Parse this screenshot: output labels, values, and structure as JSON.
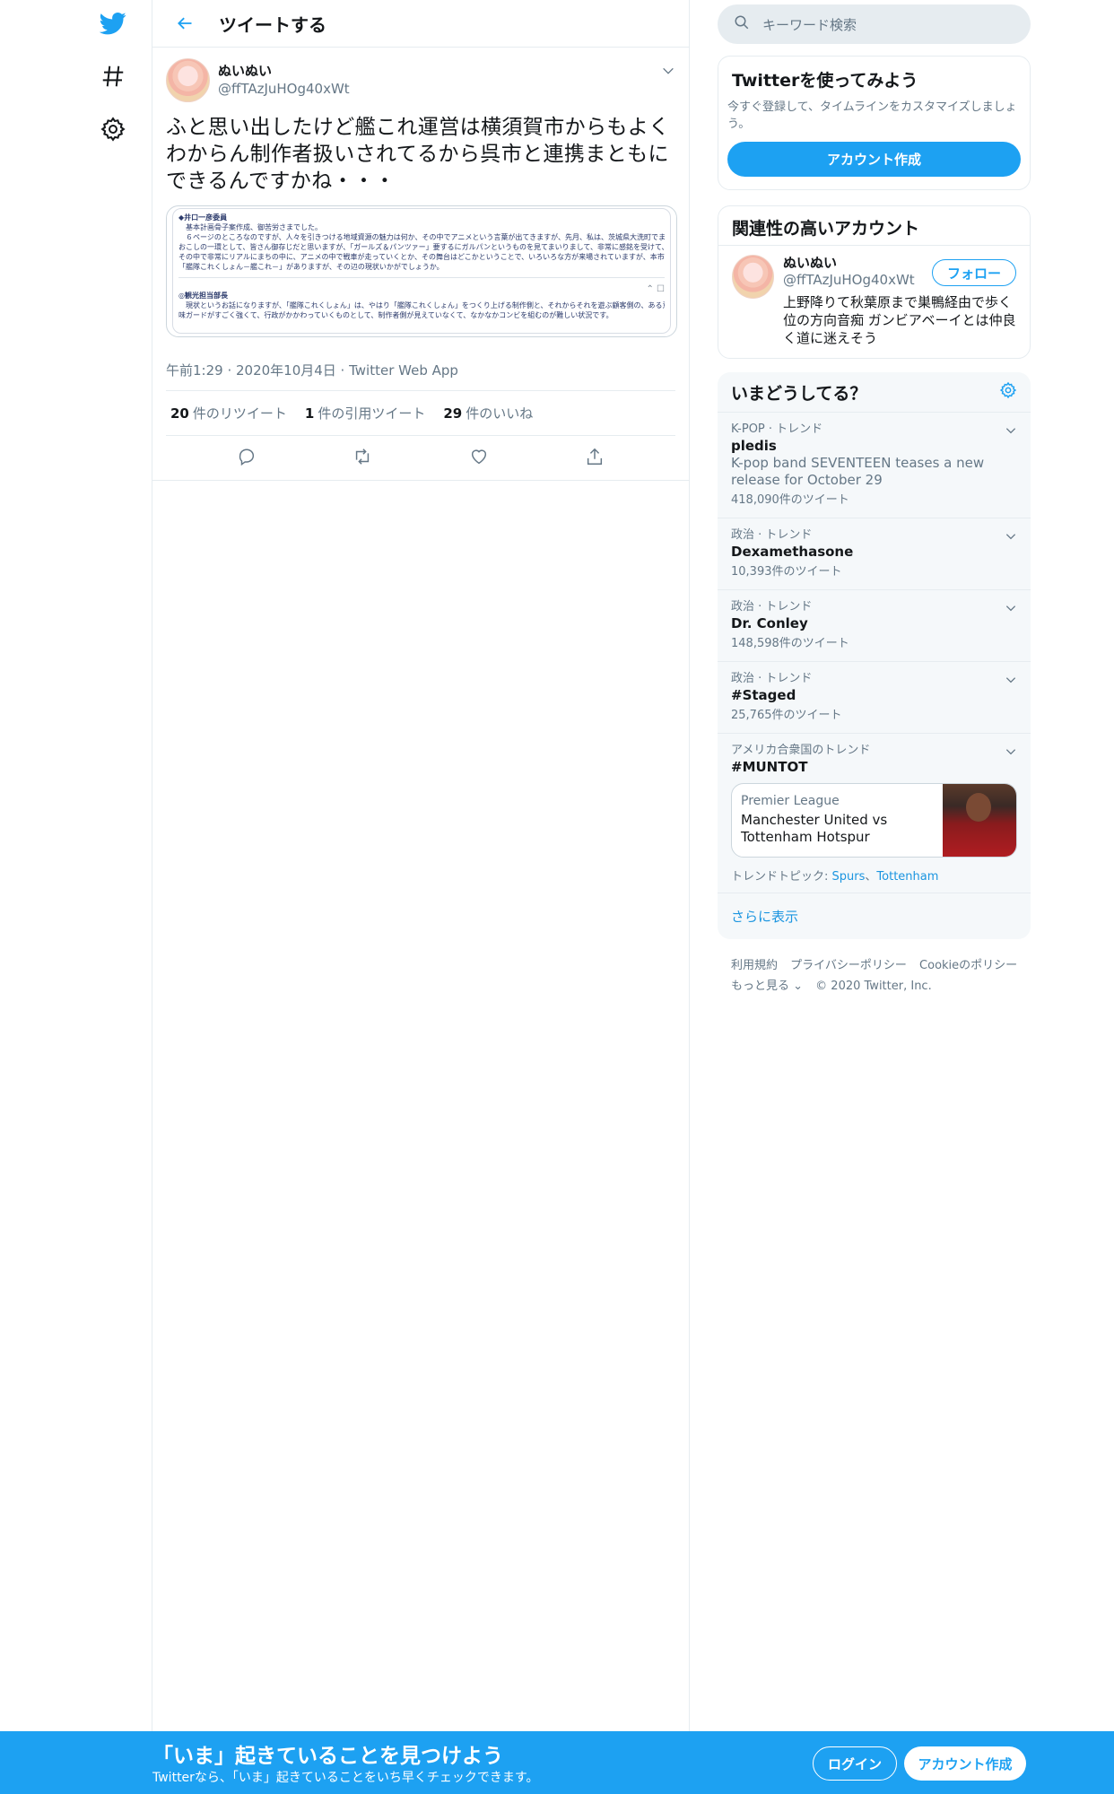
{
  "colors": {
    "accent": "#1da1f2",
    "link": "#1b95e0",
    "muted": "#657786",
    "text": "#14171a"
  },
  "nav": {
    "icons": [
      "twitter-logo-icon",
      "hashtag-icon",
      "settings-icon"
    ]
  },
  "header": {
    "title": "ツイートする"
  },
  "tweet": {
    "author_name": "ぬいぬい",
    "author_handle": "@ffTAzJuHOg40xWt",
    "text": "ふと思い出したけど艦これ運営は横須賀市からもよくわからん制作者扱いされてるから呉市と連携まともにできるんですかね・・・",
    "media_lines": [
      "◆井口一彦委員",
      "　基本計画骨子案作成、御苦労さまでした。",
      "　６ページのところなのですが、人々を引きつける地域資源の魅力は何か、その中でアニメという言葉が出てきますが、先月、私は、茨城県大洗町でまち",
      "おこしの一環として、皆さん御存じだと思いますが、「ガールズ＆パンツァー」要するにガルパンというものを見てまいりまして、非常に感銘を受けて、",
      "その中で非常にリアルにまちの中に、アニメの中で戦車が走っていくとか、その舞台はどこかということで、いろいろな方が来場されていますが、本市は",
      "「艦隊これくしょん－艦これ－」がありますが、その辺の現状いかがでしょうか。",
      "◎観光担当部長",
      "　現状というお話になりますが、「艦隊これくしょん」は、やはり「艦隊これくしょん」をつくり上げる制作側と、それからそれを遊ぶ顧客側の、ある意",
      "味ガードがすごく強くて、行政がかかわっていくものとして、制作者側が見えていなくて、なかなかコンビを組むのが難しい状況です。"
    ],
    "meta": "午前1:29 · 2020年10月4日 · Twitter Web App",
    "retweets_count": "20",
    "retweets_label": "件のリツイート",
    "quotes_count": "1",
    "quotes_label": "件の引用ツイート",
    "likes_count": "29",
    "likes_label": "件のいいね"
  },
  "search": {
    "placeholder": "キーワード検索"
  },
  "signup_card": {
    "title": "Twitterを使ってみよう",
    "description": "今すぐ登録して、タイムラインをカスタマイズしましょう。",
    "button": "アカウント作成"
  },
  "related": {
    "title": "関連性の高いアカウント",
    "name": "ぬいぬい",
    "handle": "@ffTAzJuHOg40xWt",
    "follow_button": "フォロー",
    "bio": "上野降りて秋葉原まで巣鴨経由で歩く位の方向音痴 ガンビアベーイとは仲良く道に迷えそう"
  },
  "trends": {
    "title": "いまどうしてる？",
    "items": [
      {
        "context": "K-POP · トレンド",
        "name": "pledis",
        "description": "K-pop band SEVENTEEN teases a new release for October 29",
        "count": "418,090件のツイート"
      },
      {
        "context": "政治 · トレンド",
        "name": "Dexamethasone",
        "count": "10,393件のツイート"
      },
      {
        "context": "政治 · トレンド",
        "name": "Dr. Conley",
        "count": "148,598件のツイート"
      },
      {
        "context": "政治 · トレンド",
        "name": "#Staged",
        "count": "25,765件のツイート"
      },
      {
        "context": "アメリカ合衆国のトレンド",
        "name": "#MUNTOT"
      }
    ],
    "event": {
      "source": "Premier League",
      "title": "Manchester United vs Tottenham Hotspur"
    },
    "topics_label": "トレンドトピック: ",
    "topic_1": "Spurs",
    "topic_sep": "、",
    "topic_2": "Tottenham",
    "show_more": "さらに表示"
  },
  "footer": {
    "terms": "利用規約",
    "privacy": "プライバシーポリシー",
    "cookie": "Cookieのポリシー",
    "more": "もっと見る ⌄",
    "copyright": "© 2020 Twitter, Inc."
  },
  "bottom_bar": {
    "title": "「いま」起きていることを見つけよう",
    "subtitle": "Twitterなら、「いま」起きていることをいち早くチェックできます。",
    "login": "ログイン",
    "signup": "アカウント作成"
  }
}
